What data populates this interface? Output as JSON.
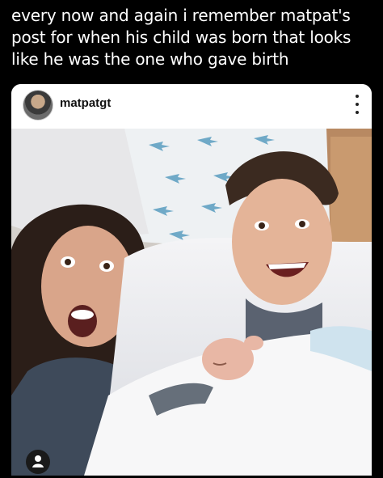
{
  "caption": {
    "line1": "every now and again i remember matpat's",
    "line2": "post for when his child was born that looks",
    "line3": "like he was the one who gave birth"
  },
  "post": {
    "username": "matpatgt",
    "avatar_icon": "profile-avatar",
    "more_icon": "more-vertical-icon"
  },
  "bottom": {
    "icon": "user-icon"
  },
  "colors": {
    "background": "#000000",
    "card": "#ffffff",
    "text_primary": "#ffffff",
    "username": "#111111"
  }
}
